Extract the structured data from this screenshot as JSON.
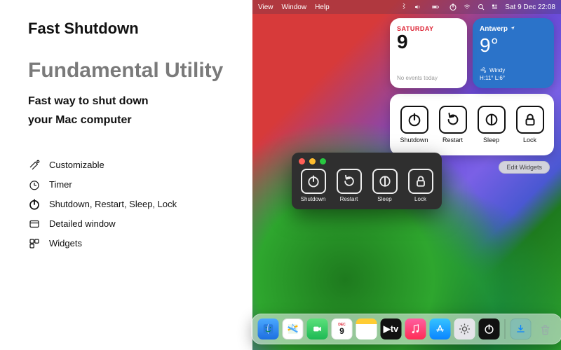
{
  "promo": {
    "title": "Fast Shutdown",
    "headline": "Fundamental Utility",
    "sub1": "Fast way to shut down",
    "sub2": "your Mac computer",
    "features": [
      {
        "icon": "customizable-icon",
        "label": "Customizable"
      },
      {
        "icon": "timer-icon",
        "label": "Timer"
      },
      {
        "icon": "power-icon",
        "label": "Shutdown, Restart, Sleep, Lock"
      },
      {
        "icon": "window-icon",
        "label": "Detailed window"
      },
      {
        "icon": "widgets-icon",
        "label": "Widgets"
      }
    ]
  },
  "menubar": {
    "items": [
      "View",
      "Window",
      "Help"
    ],
    "battery": "82",
    "clock": "Sat 9 Dec  22:08"
  },
  "widgets": {
    "calendar": {
      "day_label": "SATURDAY",
      "day_num": "9",
      "note": "No events today"
    },
    "weather": {
      "city": "Antwerp",
      "temp": "9°",
      "cond": "Windy",
      "hl": "H:11° L:6°"
    },
    "actions": [
      {
        "name": "shutdown",
        "label": "Shutdown"
      },
      {
        "name": "restart",
        "label": "Restart"
      },
      {
        "name": "sleep",
        "label": "Sleep"
      },
      {
        "name": "lock",
        "label": "Lock"
      }
    ],
    "edit_label": "Edit Widgets"
  },
  "appwin": {
    "buttons": [
      {
        "name": "shutdown",
        "label": "Shutdown"
      },
      {
        "name": "restart",
        "label": "Restart"
      },
      {
        "name": "sleep",
        "label": "Sleep"
      },
      {
        "name": "lock",
        "label": "Lock"
      }
    ]
  },
  "dock": {
    "cal_month": "DEC",
    "cal_day": "9",
    "tv_label": "▶tv"
  }
}
